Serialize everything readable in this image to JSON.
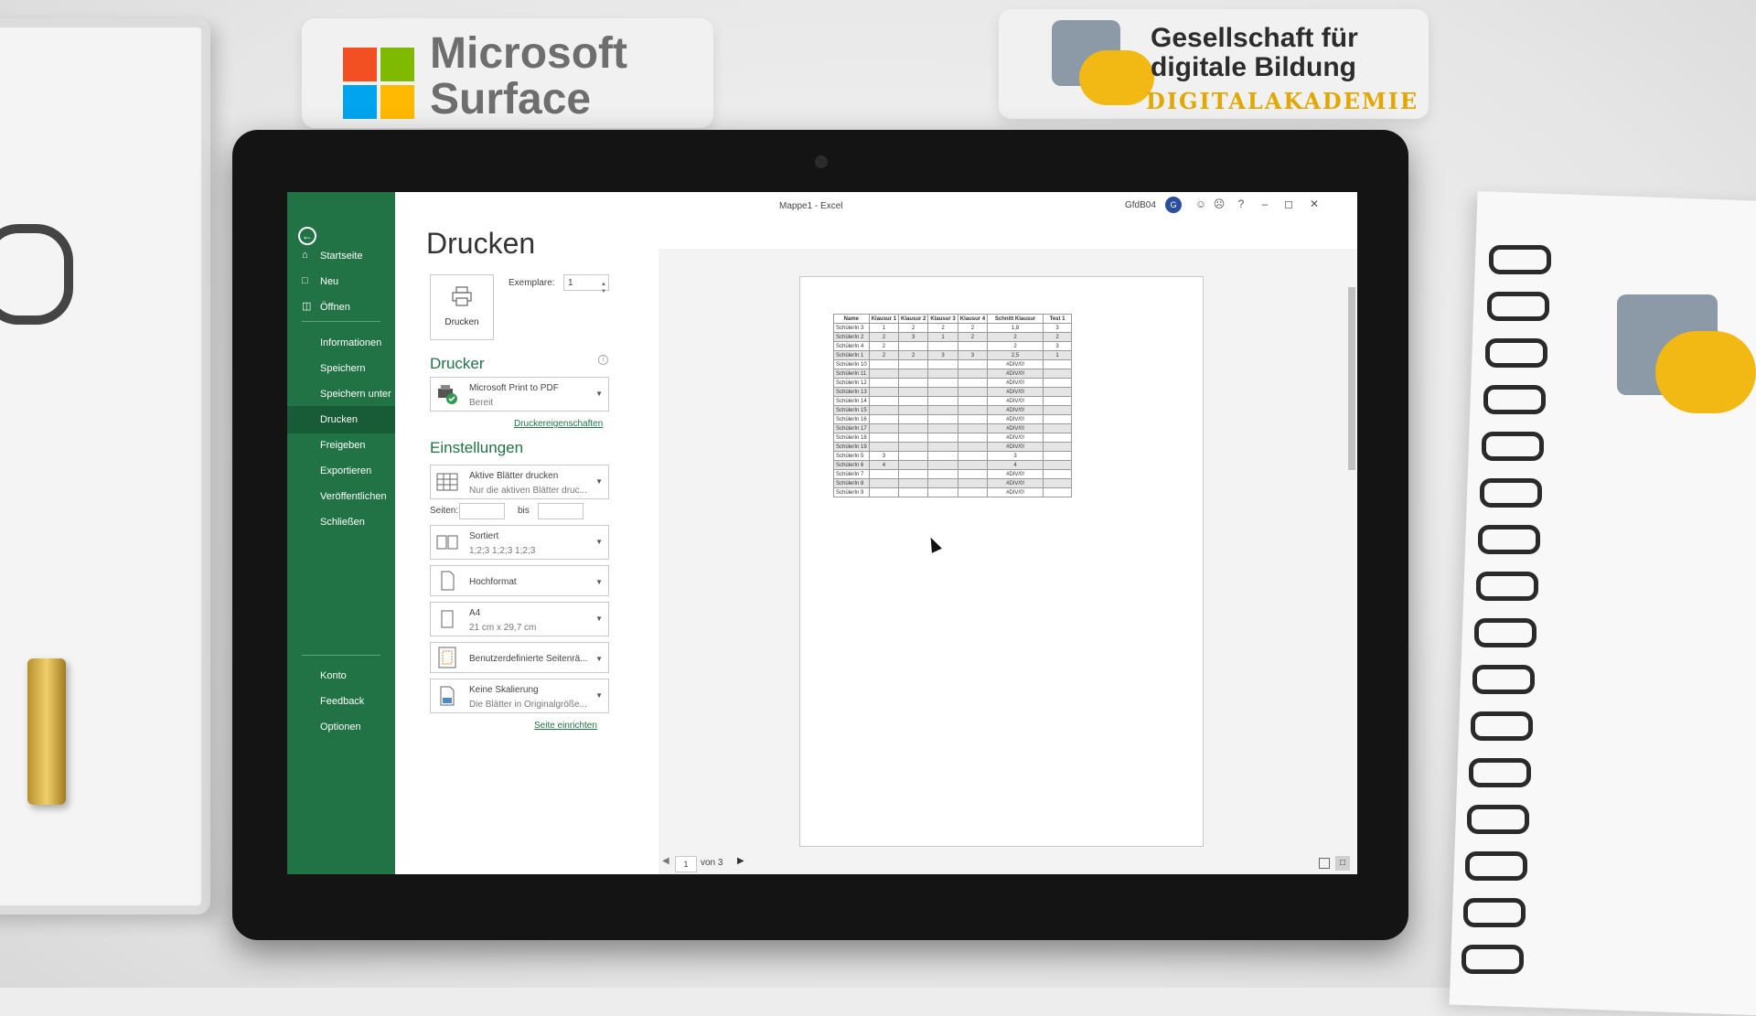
{
  "window": {
    "title": "Mappe1  -  Excel",
    "user": "GfdB04",
    "avatar_initial": "G"
  },
  "branding": {
    "microsoft_line1": "Microsoft",
    "microsoft_line2": "Surface",
    "gfdb_line1": "Gesellschaft für",
    "gfdb_line2": "digitale Bildung",
    "gfdb_line3": "DIGITALAKADEMIE",
    "colors": {
      "ms_red": "#f25022",
      "ms_green": "#7fba00",
      "ms_blue": "#00a4ef",
      "ms_yellow": "#ffb900",
      "gfdb_gold": "#f2b813"
    }
  },
  "sidebar": {
    "back_icon": "back-arrow-icon",
    "top_items": [
      {
        "label": "Startseite",
        "icon": "home-icon"
      },
      {
        "label": "Neu",
        "icon": "new-file-icon"
      },
      {
        "label": "Öffnen",
        "icon": "folder-open-icon"
      }
    ],
    "middle_items": [
      {
        "label": "Informationen"
      },
      {
        "label": "Speichern"
      },
      {
        "label": "Speichern unter"
      },
      {
        "label": "Drucken",
        "active": true
      },
      {
        "label": "Freigeben"
      },
      {
        "label": "Exportieren"
      },
      {
        "label": "Veröffentlichen"
      },
      {
        "label": "Schließen"
      }
    ],
    "bottom_items": [
      {
        "label": "Konto"
      },
      {
        "label": "Feedback"
      },
      {
        "label": "Optionen"
      }
    ],
    "accent_color": "#217346"
  },
  "print": {
    "heading": "Drucken",
    "button_label": "Drucken",
    "copies_label": "Exemplare:",
    "copies_value": "1",
    "printer_heading": "Drucker",
    "printer_name": "Microsoft Print to PDF",
    "printer_status": "Bereit",
    "printer_properties_link": "Druckereigenschaften",
    "settings_heading": "Einstellungen",
    "settings": {
      "what": {
        "line1": "Aktive Blätter drucken",
        "line2": "Nur die aktiven Blätter druc..."
      },
      "pages_label": "Seiten:",
      "pages_to_label": "bis",
      "collate": {
        "line1": "Sortiert",
        "line2": "1;2;3    1;2;3    1;2;3"
      },
      "orientation": "Hochformat",
      "paper": {
        "line1": "A4",
        "line2": "21 cm x 29,7 cm"
      },
      "margins": "Benutzerdefinierte Seitenrä...",
      "scaling": {
        "line1": "Keine Skalierung",
        "line2": "Die Blätter in Originalgröße..."
      }
    },
    "page_setup_link": "Seite einrichten"
  },
  "preview": {
    "current_page": "1",
    "page_total": "von 3",
    "table": {
      "headers": [
        "Name",
        "Klausur 1",
        "Klausur 2",
        "Klausur 3",
        "Klausur 4",
        "Schnitt Klausur",
        "Test 1"
      ],
      "rows": [
        [
          "SchülerIn 3",
          "1",
          "2",
          "2",
          "2",
          "1,8",
          "3"
        ],
        [
          "SchülerIn 2",
          "2",
          "3",
          "1",
          "2",
          "2",
          "2"
        ],
        [
          "SchülerIn 4",
          "2",
          "",
          "",
          "",
          "2",
          "3"
        ],
        [
          "SchülerIn 1",
          "2",
          "2",
          "3",
          "3",
          "2,5",
          "1"
        ],
        [
          "SchülerIn 10",
          "",
          "",
          "",
          "",
          "#DIV/0!",
          ""
        ],
        [
          "SchülerIn 11",
          "",
          "",
          "",
          "",
          "#DIV/0!",
          ""
        ],
        [
          "SchülerIn 12",
          "",
          "",
          "",
          "",
          "#DIV/0!",
          ""
        ],
        [
          "SchülerIn 13",
          "",
          "",
          "",
          "",
          "#DIV/0!",
          ""
        ],
        [
          "SchülerIn 14",
          "",
          "",
          "",
          "",
          "#DIV/0!",
          ""
        ],
        [
          "SchülerIn 15",
          "",
          "",
          "",
          "",
          "#DIV/0!",
          ""
        ],
        [
          "SchülerIn 16",
          "",
          "",
          "",
          "",
          "#DIV/0!",
          ""
        ],
        [
          "SchülerIn 17",
          "",
          "",
          "",
          "",
          "#DIV/0!",
          ""
        ],
        [
          "SchülerIn 18",
          "",
          "",
          "",
          "",
          "#DIV/0!",
          ""
        ],
        [
          "SchülerIn 19",
          "",
          "",
          "",
          "",
          "#DIV/0!",
          ""
        ],
        [
          "SchülerIn 5",
          "3",
          "",
          "",
          "",
          "3",
          ""
        ],
        [
          "SchülerIn 6",
          "4",
          "",
          "",
          "",
          "4",
          ""
        ],
        [
          "SchülerIn 7",
          "",
          "",
          "",
          "",
          "#DIV/0!",
          ""
        ],
        [
          "SchülerIn 8",
          "",
          "",
          "",
          "",
          "#DIV/0!",
          ""
        ],
        [
          "SchülerIn 9",
          "",
          "",
          "",
          "",
          "#DIV/0!",
          ""
        ]
      ]
    }
  }
}
